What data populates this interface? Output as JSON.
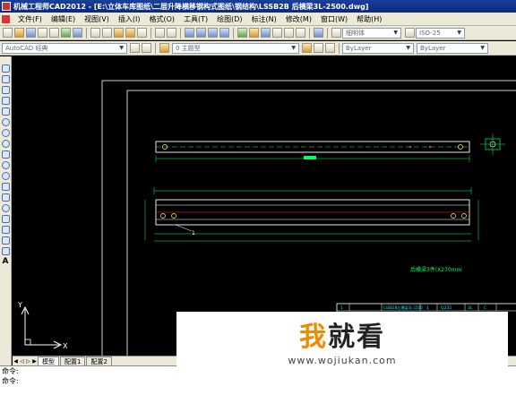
{
  "window": {
    "title": "机械工程师CAD2012 - [E:\\立体车库图纸\\二层升降横移钢构式图纸\\钢结构\\LSSB2B 后横梁3L-2500.dwg]"
  },
  "menu": {
    "items": [
      {
        "id": "file",
        "label": "文件(F)"
      },
      {
        "id": "edit",
        "label": "编辑(E)"
      },
      {
        "id": "view",
        "label": "视图(V)"
      },
      {
        "id": "insert",
        "label": "插入(I)"
      },
      {
        "id": "format",
        "label": "格式(O)"
      },
      {
        "id": "tools",
        "label": "工具(T)"
      },
      {
        "id": "draw",
        "label": "绘图(D)"
      },
      {
        "id": "dimension",
        "label": "标注(N)"
      },
      {
        "id": "modify",
        "label": "修改(M)"
      },
      {
        "id": "window",
        "label": "窗口(W)"
      },
      {
        "id": "help",
        "label": "帮助(H)"
      }
    ]
  },
  "toolbar": {
    "text_style": "细明体",
    "dim_style": "ISO-25",
    "workspace": "AutoCAD 经典",
    "layer": "0 主题型",
    "color": "ByLayer",
    "linetype": "ByLayer"
  },
  "canvas": {
    "background": "#000000",
    "accent_green": "#00ff66",
    "accent_white": "#ffffff",
    "accent_red": "#ff3030",
    "accent_cyan": "#00e5ff",
    "callout_label": "1",
    "annotation": "后横梁3件(X270mm",
    "title_block_row": [
      "1",
      "LSSB2B后横梁3L-2500",
      "1",
      "Q235",
      "3L",
      "C"
    ]
  },
  "ucs": {
    "x_label": "X",
    "y_label": "Y"
  },
  "tabs": {
    "items": [
      {
        "id": "model",
        "label": "模型"
      },
      {
        "id": "layout1",
        "label": "配置1"
      },
      {
        "id": "layout2",
        "label": "配置2"
      }
    ],
    "active": "model"
  },
  "command": {
    "lines": [
      "命令:",
      "命令:"
    ]
  },
  "watermark": {
    "logo_first": "我",
    "logo_rest": "就看",
    "url": "www.wojiukan.com"
  }
}
